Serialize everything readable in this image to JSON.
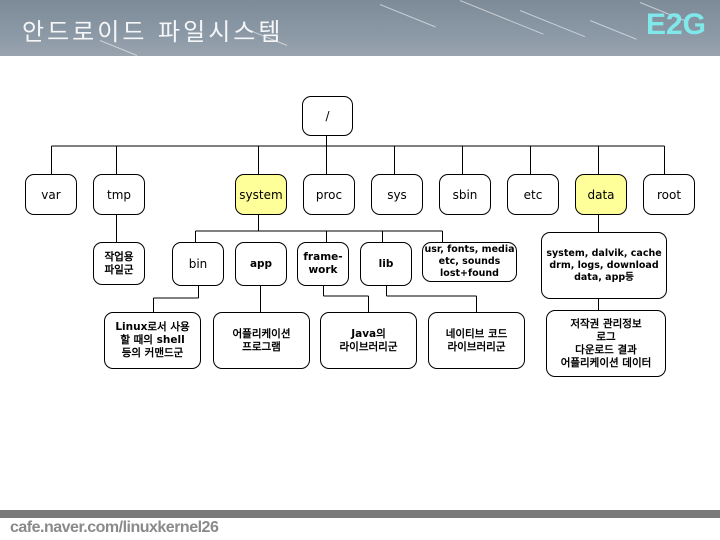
{
  "header": {
    "title": "안드로이드 파일시스템",
    "logo": "E2G"
  },
  "tree": {
    "root": {
      "label": "/"
    },
    "level1": [
      {
        "label": "var",
        "highlight": false
      },
      {
        "label": "tmp",
        "highlight": false
      },
      {
        "label": "system",
        "highlight": true
      },
      {
        "label": "proc",
        "highlight": false
      },
      {
        "label": "sys",
        "highlight": false
      },
      {
        "label": "sbin",
        "highlight": false
      },
      {
        "label": "etc",
        "highlight": false
      },
      {
        "label": "data",
        "highlight": true
      },
      {
        "label": "root",
        "highlight": false
      }
    ],
    "tmp_child": "작업용\n파일군",
    "system_children": [
      {
        "label": "bin"
      },
      {
        "label": "app"
      },
      {
        "label": "frame-\nwork"
      },
      {
        "label": "lib"
      },
      {
        "label": "usr, fonts, media\netc, sounds\nlost+found"
      }
    ],
    "data_child": "system, dalvik, cache\ndrm, logs, download\ndata, app등",
    "descriptions": {
      "bin": "Linux로서 사용\n할 때의 shell\n등의 커맨드군",
      "app": "어플리케이션\n프로그램",
      "framework": "Java의\n라이브러리군",
      "lib": "네이티브 코드\n라이브러리군",
      "data": "저작권 관리정보\n로그\n다운로드 결과\n어플리케이션 데이터"
    }
  },
  "footer": {
    "text": "cafe.naver.com/linuxkernel26"
  },
  "colors": {
    "highlight": "#ffff99",
    "logo": "#7fe8ea",
    "footer_bar": "#7a7a7a"
  }
}
